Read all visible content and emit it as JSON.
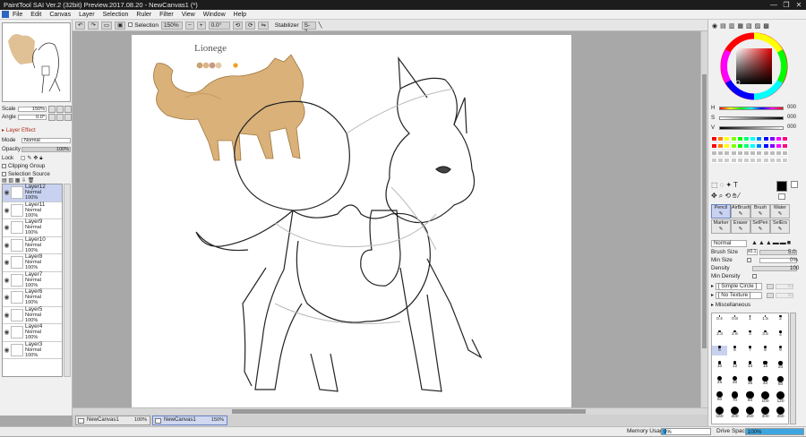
{
  "window": {
    "title": "PaintTool SAI Ver.2 (32bit) Preview.2017.08.20 - NewCanvas1 (*)",
    "controls": [
      "—",
      "❐",
      "✕"
    ]
  },
  "menu": [
    "File",
    "Edit",
    "Canvas",
    "Layer",
    "Selection",
    "Ruler",
    "Filter",
    "View",
    "Window",
    "Help"
  ],
  "toolbar": {
    "selection_label": "Selection",
    "zoom": "150%",
    "angle": "0.0°",
    "stabilizer_label": "Stabilizer",
    "stabilizer_value": "S-2"
  },
  "navigator": {
    "scale_label": "Scale",
    "scale_value": "150%",
    "angle_label": "Angle",
    "angle_value": "0.0°"
  },
  "layer_effect": {
    "header": "Layer Effect",
    "mode_label": "Mode",
    "mode_value": "Normal",
    "opacity_label": "Opacity",
    "opacity_value": "100%",
    "lock_label": "Lock",
    "clipping_group": "Clipping Group",
    "selection_source": "Selection Source"
  },
  "layers": [
    {
      "name": "Layer12",
      "mode": "Normal",
      "opacity": "100%",
      "selected": true
    },
    {
      "name": "Layer11",
      "mode": "Normal",
      "opacity": "100%",
      "selected": false
    },
    {
      "name": "Layer9",
      "mode": "Normal",
      "opacity": "100%",
      "selected": false
    },
    {
      "name": "Layer10",
      "mode": "Normal",
      "opacity": "100%",
      "selected": false
    },
    {
      "name": "Layer8",
      "mode": "Normal",
      "opacity": "100%",
      "selected": false
    },
    {
      "name": "Layer7",
      "mode": "Normal",
      "opacity": "100%",
      "selected": false
    },
    {
      "name": "Layer6",
      "mode": "Normal",
      "opacity": "100%",
      "selected": false
    },
    {
      "name": "Layer5",
      "mode": "Normal",
      "opacity": "100%",
      "selected": false
    },
    {
      "name": "Layer4",
      "mode": "Normal",
      "opacity": "100%",
      "selected": false
    },
    {
      "name": "Layer3",
      "mode": "Normal",
      "opacity": "100%",
      "selected": false
    }
  ],
  "canvas": {
    "reference_label": "Lionege"
  },
  "tabs": [
    {
      "name": "NewCanvas1",
      "zoom": "100%",
      "active": false
    },
    {
      "name": "NewCanvas1",
      "zoom": "150%",
      "active": true
    }
  ],
  "status": {
    "memory_label": "Memory Usage",
    "memory_value": "9%",
    "memory_fraction": 0.09,
    "drive_label": "Drive Space",
    "drive_value": "100%",
    "drive_fraction": 1.0
  },
  "color": {
    "hsv": [
      {
        "label": "H",
        "value": "000"
      },
      {
        "label": "S",
        "value": "000"
      },
      {
        "label": "V",
        "value": "000"
      }
    ],
    "primary": "#000000",
    "swatches": [
      "#ff0000",
      "#ff8000",
      "#ffff00",
      "#80ff00",
      "#00ff00",
      "#00ff80",
      "#00ffff",
      "#0080ff",
      "#0000ff",
      "#8000ff",
      "#ff00ff",
      "#ff0080",
      "#808080"
    ]
  },
  "tools": {
    "row1": [
      "Pencil",
      "AirBrush",
      "Brush",
      "Water"
    ],
    "row2": [
      "Marker",
      "Eraser",
      "SelPen",
      "SelErs"
    ],
    "blend_mode": "Normal",
    "brush_size_label": "Brush Size",
    "brush_size_mult": "x0.1",
    "brush_size_value": "5.0",
    "min_size_label": "Min Size",
    "min_size_value": "0%",
    "density_label": "Density",
    "density_value": "100",
    "min_density_label": "Min Density",
    "shape_value": "[ Simple Circle ]",
    "shape_amount": "50",
    "texture_value": "[ No Texture ]",
    "texture_amount": "95",
    "misc_label": "Miscellaneous",
    "brush_sizes": [
      "0.4",
      "0.8",
      "1",
      "1.5",
      "2",
      "2.3",
      "2.6",
      "3",
      "3.5",
      "4",
      "5",
      "6",
      "7",
      "8",
      "9",
      "10",
      "12",
      "14",
      "16",
      "20",
      "25",
      "30",
      "35",
      "40",
      "50",
      "60",
      "70",
      "80",
      "100",
      "120",
      "160",
      "200",
      "250",
      "300",
      "350"
    ]
  }
}
